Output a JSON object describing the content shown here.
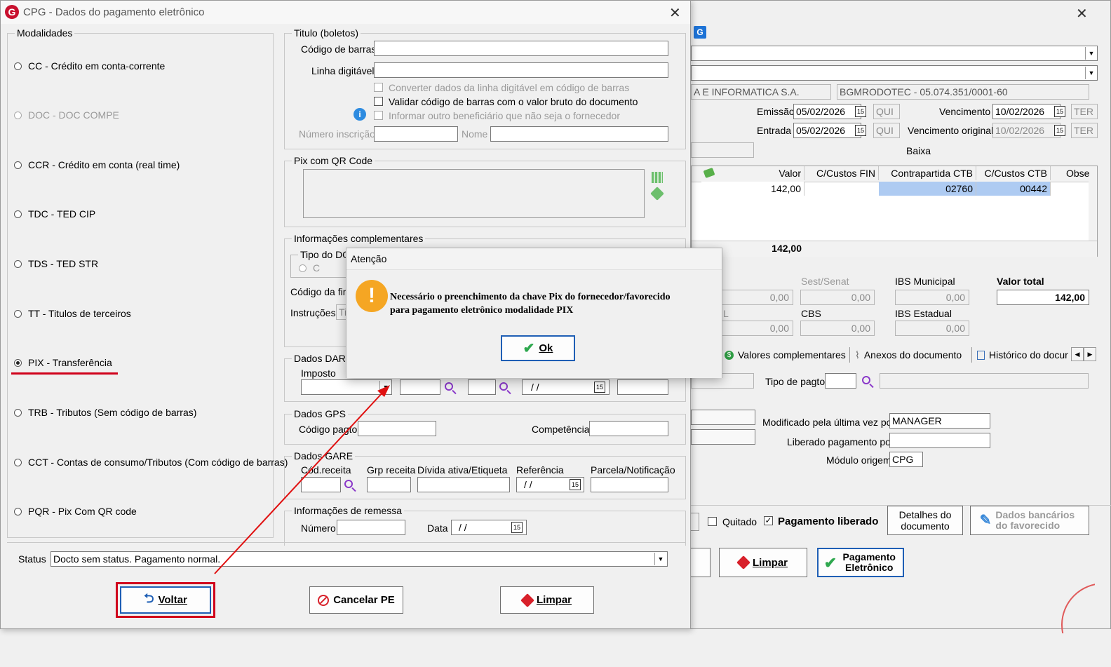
{
  "main_window": {
    "emissao_label": "Emissão",
    "emissao_value": "05/02/2026",
    "emissao_day": "QUI",
    "entrada_label": "Entrada",
    "entrada_value": "05/02/2026",
    "entrada_day": "QUI",
    "vencimento_label": "Vencimento",
    "vencimento_value": "10/02/2026",
    "vencimento_day": "TER",
    "venc_original_label": "Vencimento original",
    "venc_original_value": "10/02/2026",
    "venc_original_day": "TER",
    "empresa_value": "A E INFORMATICA S.A.",
    "fornecedor_value": "BGMRODOTEC - 05.074.351/0001-60",
    "baixa_label": "Baixa",
    "grid": {
      "headers": [
        "Valor",
        "C/Custos FIN",
        "Contrapartida CTB",
        "C/Custos CTB",
        "Obse"
      ],
      "row": [
        "142,00",
        "",
        "02760",
        "00442",
        ""
      ],
      "total": "142,00"
    },
    "sest_senat_label": "Sest/Senat",
    "sest_senat_value": "0,00",
    "ibs_municipal_label": "IBS Municipal",
    "ibs_municipal_value": "0,00",
    "valor_total_label": "Valor total",
    "valor_total_value": "142,00",
    "left_value_1": "0,00",
    "cbs_label": "CBS",
    "cbs_value": "0,00",
    "ibs_estadual_label": "IBS Estadual",
    "ibs_estadual_value": "0,00",
    "left_value_2": "0,00",
    "left_cut_label": "L",
    "tabs": [
      "Valores complementares",
      "Anexos do documento",
      "Histórico do docur"
    ],
    "tipo_pagto_label": "Tipo de pagto",
    "modificado_label": "Modificado pela última vez por",
    "modificado_value": "MANAGER",
    "liberado_label": "Liberado pagamento por",
    "liberado_value": "",
    "modulo_label": "Módulo origem",
    "modulo_value": "CPG",
    "quitado_label": "Quitado",
    "pagamento_liberado_label": "Pagamento liberado",
    "detalhes_btn": "Detalhes do documento",
    "dados_bancarios_btn": "Dados bancários do favorecido",
    "limpar_btn": "Limpar",
    "pagamento_eletronico_btn": "Pagamento Eletrônico"
  },
  "dialog": {
    "title": "CPG - Dados do pagamento eletrônico",
    "modalidades_label": "Modalidades",
    "modalidades": [
      {
        "label": "CC  - Crédito em conta-corrente",
        "enabled": true,
        "selected": false
      },
      {
        "label": "DOC - DOC COMPE",
        "enabled": false,
        "selected": false
      },
      {
        "label": "CCR - Crédito em conta (real time)",
        "enabled": true,
        "selected": false
      },
      {
        "label": "TDC - TED CIP",
        "enabled": true,
        "selected": false
      },
      {
        "label": "TDS - TED STR",
        "enabled": true,
        "selected": false
      },
      {
        "label": "TT  - Titulos de terceiros",
        "enabled": true,
        "selected": false
      },
      {
        "label": "PIX - Transferência",
        "enabled": true,
        "selected": true
      },
      {
        "label": "TRB - Tributos (Sem código de barras)",
        "enabled": true,
        "selected": false
      },
      {
        "label": "CCT - Contas de consumo/Tributos (Com código de barras)",
        "enabled": true,
        "selected": false
      },
      {
        "label": "PQR - Pix Com QR code",
        "enabled": true,
        "selected": false
      }
    ],
    "titulo_label": "Titulo (boletos)",
    "codigo_barras_label": "Código de barras",
    "linha_digitavel_label": "Linha digitável",
    "chk_converter": "Converter dados da linha digitável em código de barras",
    "chk_validar": "Validar código de barras com o valor bruto do documento",
    "chk_informar": "Informar outro beneficiário que não seja o fornecedor",
    "numero_inscricao_label": "Número inscrição",
    "nome_label": "Nome",
    "pix_qr_label": "Pix com QR Code",
    "info_compl_label": "Informações complementares",
    "tipo_do_label": "Tipo do DO",
    "tipo_c_label": "C",
    "codigo_fina_label": "Código da fina",
    "instrucoes_label": "Instruções",
    "instrucoes_value": "Ti",
    "dados_darf_label": "Dados DARF",
    "imposto_label": "Imposto",
    "date_placeholder": "/ /",
    "dados_gps_label": "Dados GPS",
    "codigo_pagto_label": "Código pagto",
    "competencia_label": "Competência",
    "dados_gare_label": "Dados GARE",
    "cod_receita_label": "Cód.receita",
    "grp_receita_label": "Grp receita",
    "divida_ativa_label": "Dívida ativa/Etiqueta",
    "referencia_label": "Referência",
    "parcela_label": "Parcela/Notificação",
    "info_remessa_label": "Informações de remessa",
    "numero_label": "Número",
    "data_label": "Data",
    "status_label": "Status",
    "status_value": "Docto sem status. Pagamento normal.",
    "voltar_btn": "Voltar",
    "cancelar_btn": "Cancelar PE",
    "limpar_btn": "Limpar"
  },
  "alert": {
    "title": "Atenção",
    "message_line1": "Necessário o preenchimento da chave Pix do fornecedor/favorecido",
    "message_line2": "para pagamento eletrônico modalidade PIX",
    "ok_btn": "Ok"
  },
  "colors": {
    "accent": "#1f5fb5",
    "highlight_red": "#d0021b",
    "warning": "#f5a623",
    "grid_selected": "#aecbf2"
  }
}
